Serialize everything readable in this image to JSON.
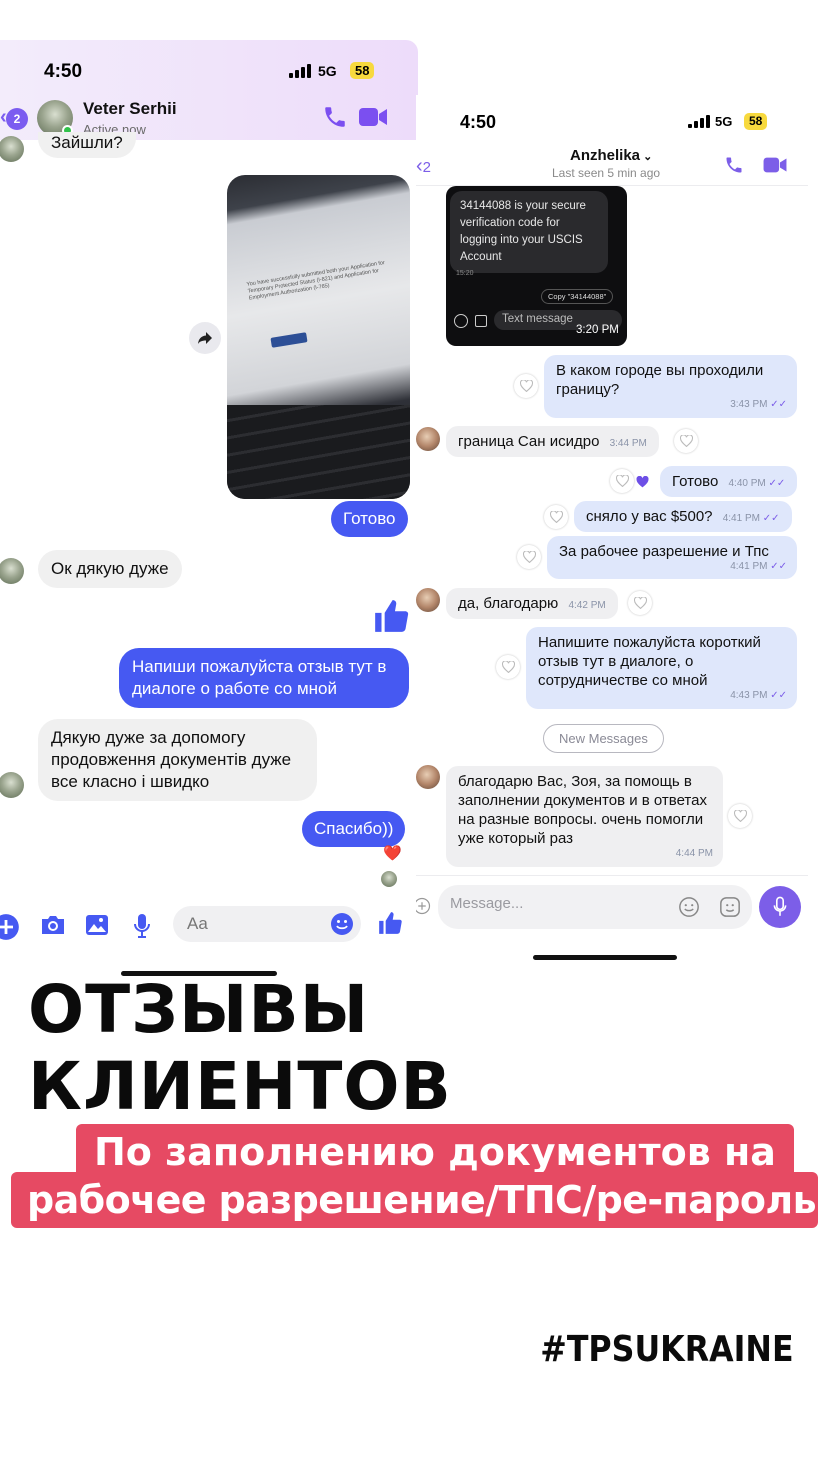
{
  "left_chat": {
    "status_time": "4:50",
    "network": "5G",
    "battery": "58",
    "back_count": "2",
    "contact_name": "Veter Serhii",
    "contact_status": "Active now",
    "messages": {
      "in_1": "Зайшли?",
      "out_1": "Готово",
      "in_2": "Ок дякую дуже",
      "out_2": "Напиши пожалуйста отзыв тут в диалоге о работе со мной",
      "in_3": "Дякую дуже за допомогу продовження документів дуже все класно і швидко",
      "out_3": "Спасибо))"
    },
    "reaction": "❤️",
    "composer_placeholder": "Aa",
    "photo_caption": "You have successfully submitted both your Application for Temporary Protected Status (I-821) and Application for Employment Authorization (I-765)"
  },
  "right_chat": {
    "status_time": "4:50",
    "network": "5G",
    "battery": "58",
    "back_count": "2",
    "contact_name": "Anzhelika",
    "last_seen": "Last seen 5 min ago",
    "sms_screenshot": {
      "code_text": "34144088 is your secure verification code for logging into your USCIS Account",
      "sms_time": "15:20",
      "copy_label": "Copy \"34144088\"",
      "input_placeholder": "Text message",
      "timestamp": "3:20 PM"
    },
    "messages": [
      {
        "dir": "out",
        "text": "В каком городе вы проходили границу?",
        "time": "3:43 PM"
      },
      {
        "dir": "in",
        "text": "граница Сан исидро",
        "time": "3:44 PM"
      },
      {
        "dir": "out",
        "text": "Готово",
        "time": "4:40 PM"
      },
      {
        "dir": "out",
        "text": "сняло у вас $500?",
        "time": "4:41 PM"
      },
      {
        "dir": "out",
        "text": "За рабочее разрешение и Тпс",
        "time": "4:41 PM"
      },
      {
        "dir": "in",
        "text": "да, благодарю",
        "time": "4:42 PM"
      },
      {
        "dir": "out",
        "text": "Напишите пожалуйста короткий отзыв тут в диалоге, о сотрудничестве со мной",
        "time": "4:43 PM"
      },
      {
        "dir": "in",
        "text": "благодарю Вас, Зоя, за помощь в заполнении документов и в ответах на разные вопросы. очень помогли уже который раз",
        "time": "4:44 PM"
      }
    ],
    "new_messages_label": "New Messages",
    "input_placeholder": "Message..."
  },
  "banner": {
    "title": "ОТЗЫВЫ КЛИЕНТОВ",
    "subtitle_line1": "По заполнению документов на",
    "subtitle_line2": "рабочее разрешение/ТПС/ре-пароль",
    "hashtag": "#TPSUKRAINE"
  },
  "colors": {
    "messenger_blue": "#4659f2",
    "viber_purple": "#7c5ee8",
    "banner_pink": "#e64a63"
  }
}
